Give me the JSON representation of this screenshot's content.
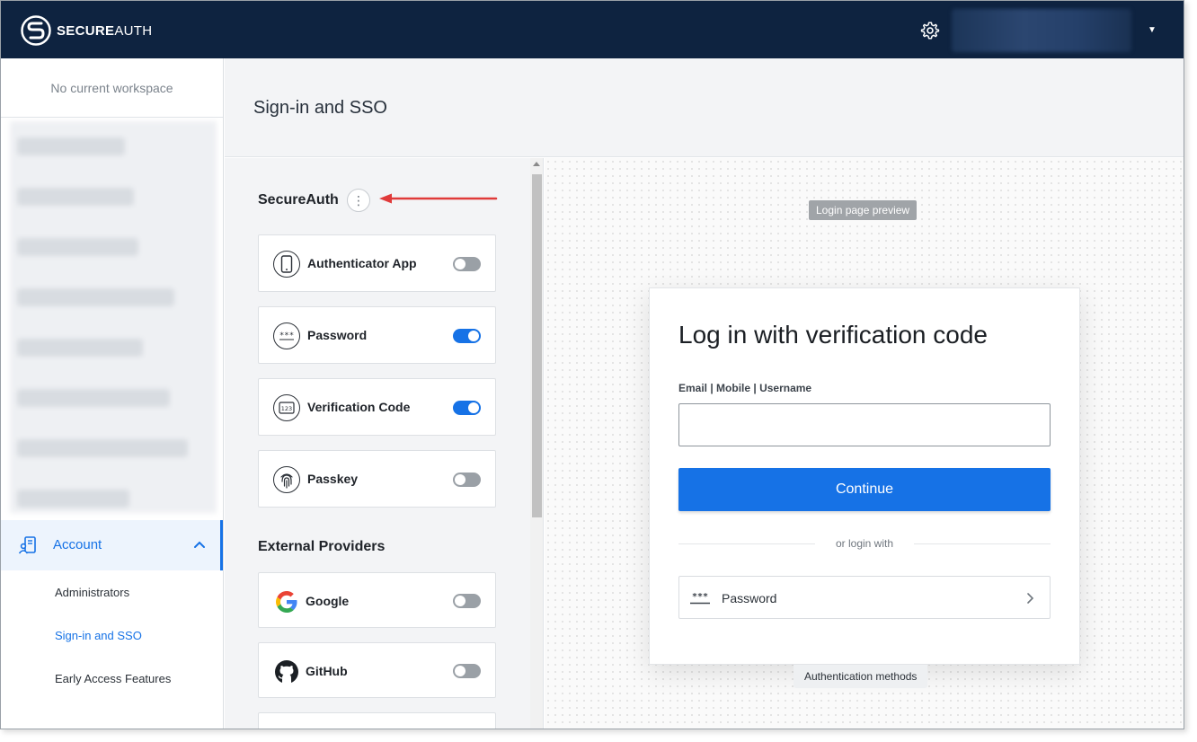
{
  "topbar": {
    "logo_bold": "SECURE",
    "logo_thin": "AUTH"
  },
  "sidebar": {
    "workspace": "No current workspace",
    "account_label": "Account",
    "subitems": [
      "Administrators",
      "Sign-in and SSO",
      "Early Access Features"
    ]
  },
  "header": {
    "title": "Sign-in and SSO"
  },
  "methods": {
    "section_title": "SecureAuth",
    "items": [
      {
        "label": "Authenticator App",
        "enabled": false
      },
      {
        "label": "Password",
        "enabled": true
      },
      {
        "label": "Verification Code",
        "enabled": true
      },
      {
        "label": "Passkey",
        "enabled": false
      }
    ],
    "external_title": "External Providers",
    "external": [
      {
        "label": "Google",
        "enabled": false
      },
      {
        "label": "GitHub",
        "enabled": false
      }
    ]
  },
  "preview": {
    "badge": "Login page preview",
    "title": "Log in with verification code",
    "field_label": "Email | Mobile | Username",
    "input_value": "",
    "continue_label": "Continue",
    "divider": "or login with",
    "alt_method": "Password",
    "bottom_badge": "Authentication methods"
  },
  "colors": {
    "topbar": "#0e2340",
    "accent": "#1672e6",
    "annotation_arrow": "#e03a3a"
  }
}
